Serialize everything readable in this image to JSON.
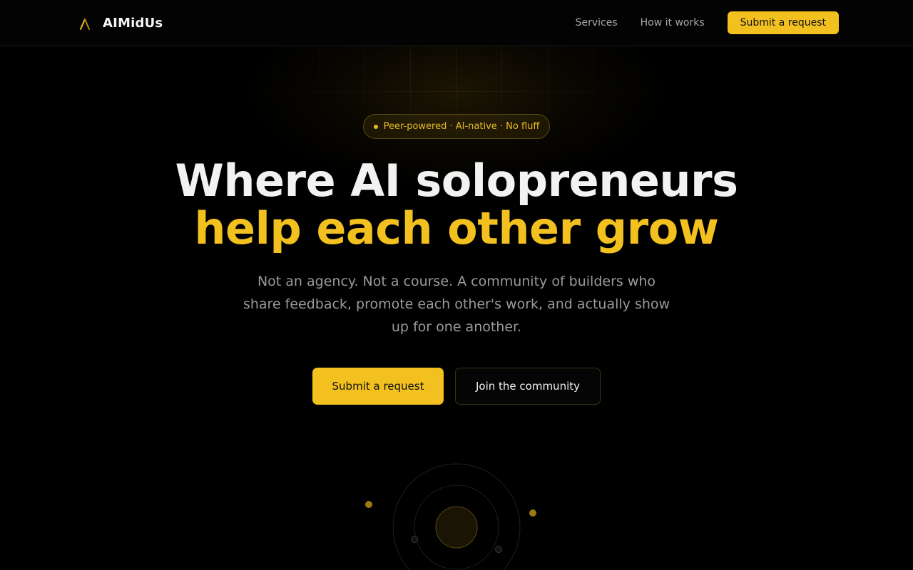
{
  "header": {
    "brand_name": "AIMidUs",
    "brand_icon": "lambda-logo-icon",
    "nav": [
      {
        "label": "Services"
      },
      {
        "label": "How it works"
      }
    ],
    "cta_label": "Submit a request"
  },
  "hero": {
    "badge": "Peer-powered · AI-native · No fluff",
    "headline_line1": "Where AI solopreneurs",
    "headline_line2": "help each other grow",
    "subtitle": "Not an agency. Not a course. A community of builders who share feedback, promote each other's work, and actually show up for one another.",
    "primary_cta": "Submit a request",
    "secondary_cta": "Join the community"
  },
  "colors": {
    "background": "#000000",
    "accent": "#f2c11f",
    "text": "#f2f2f2",
    "muted": "#9a9a9a"
  }
}
